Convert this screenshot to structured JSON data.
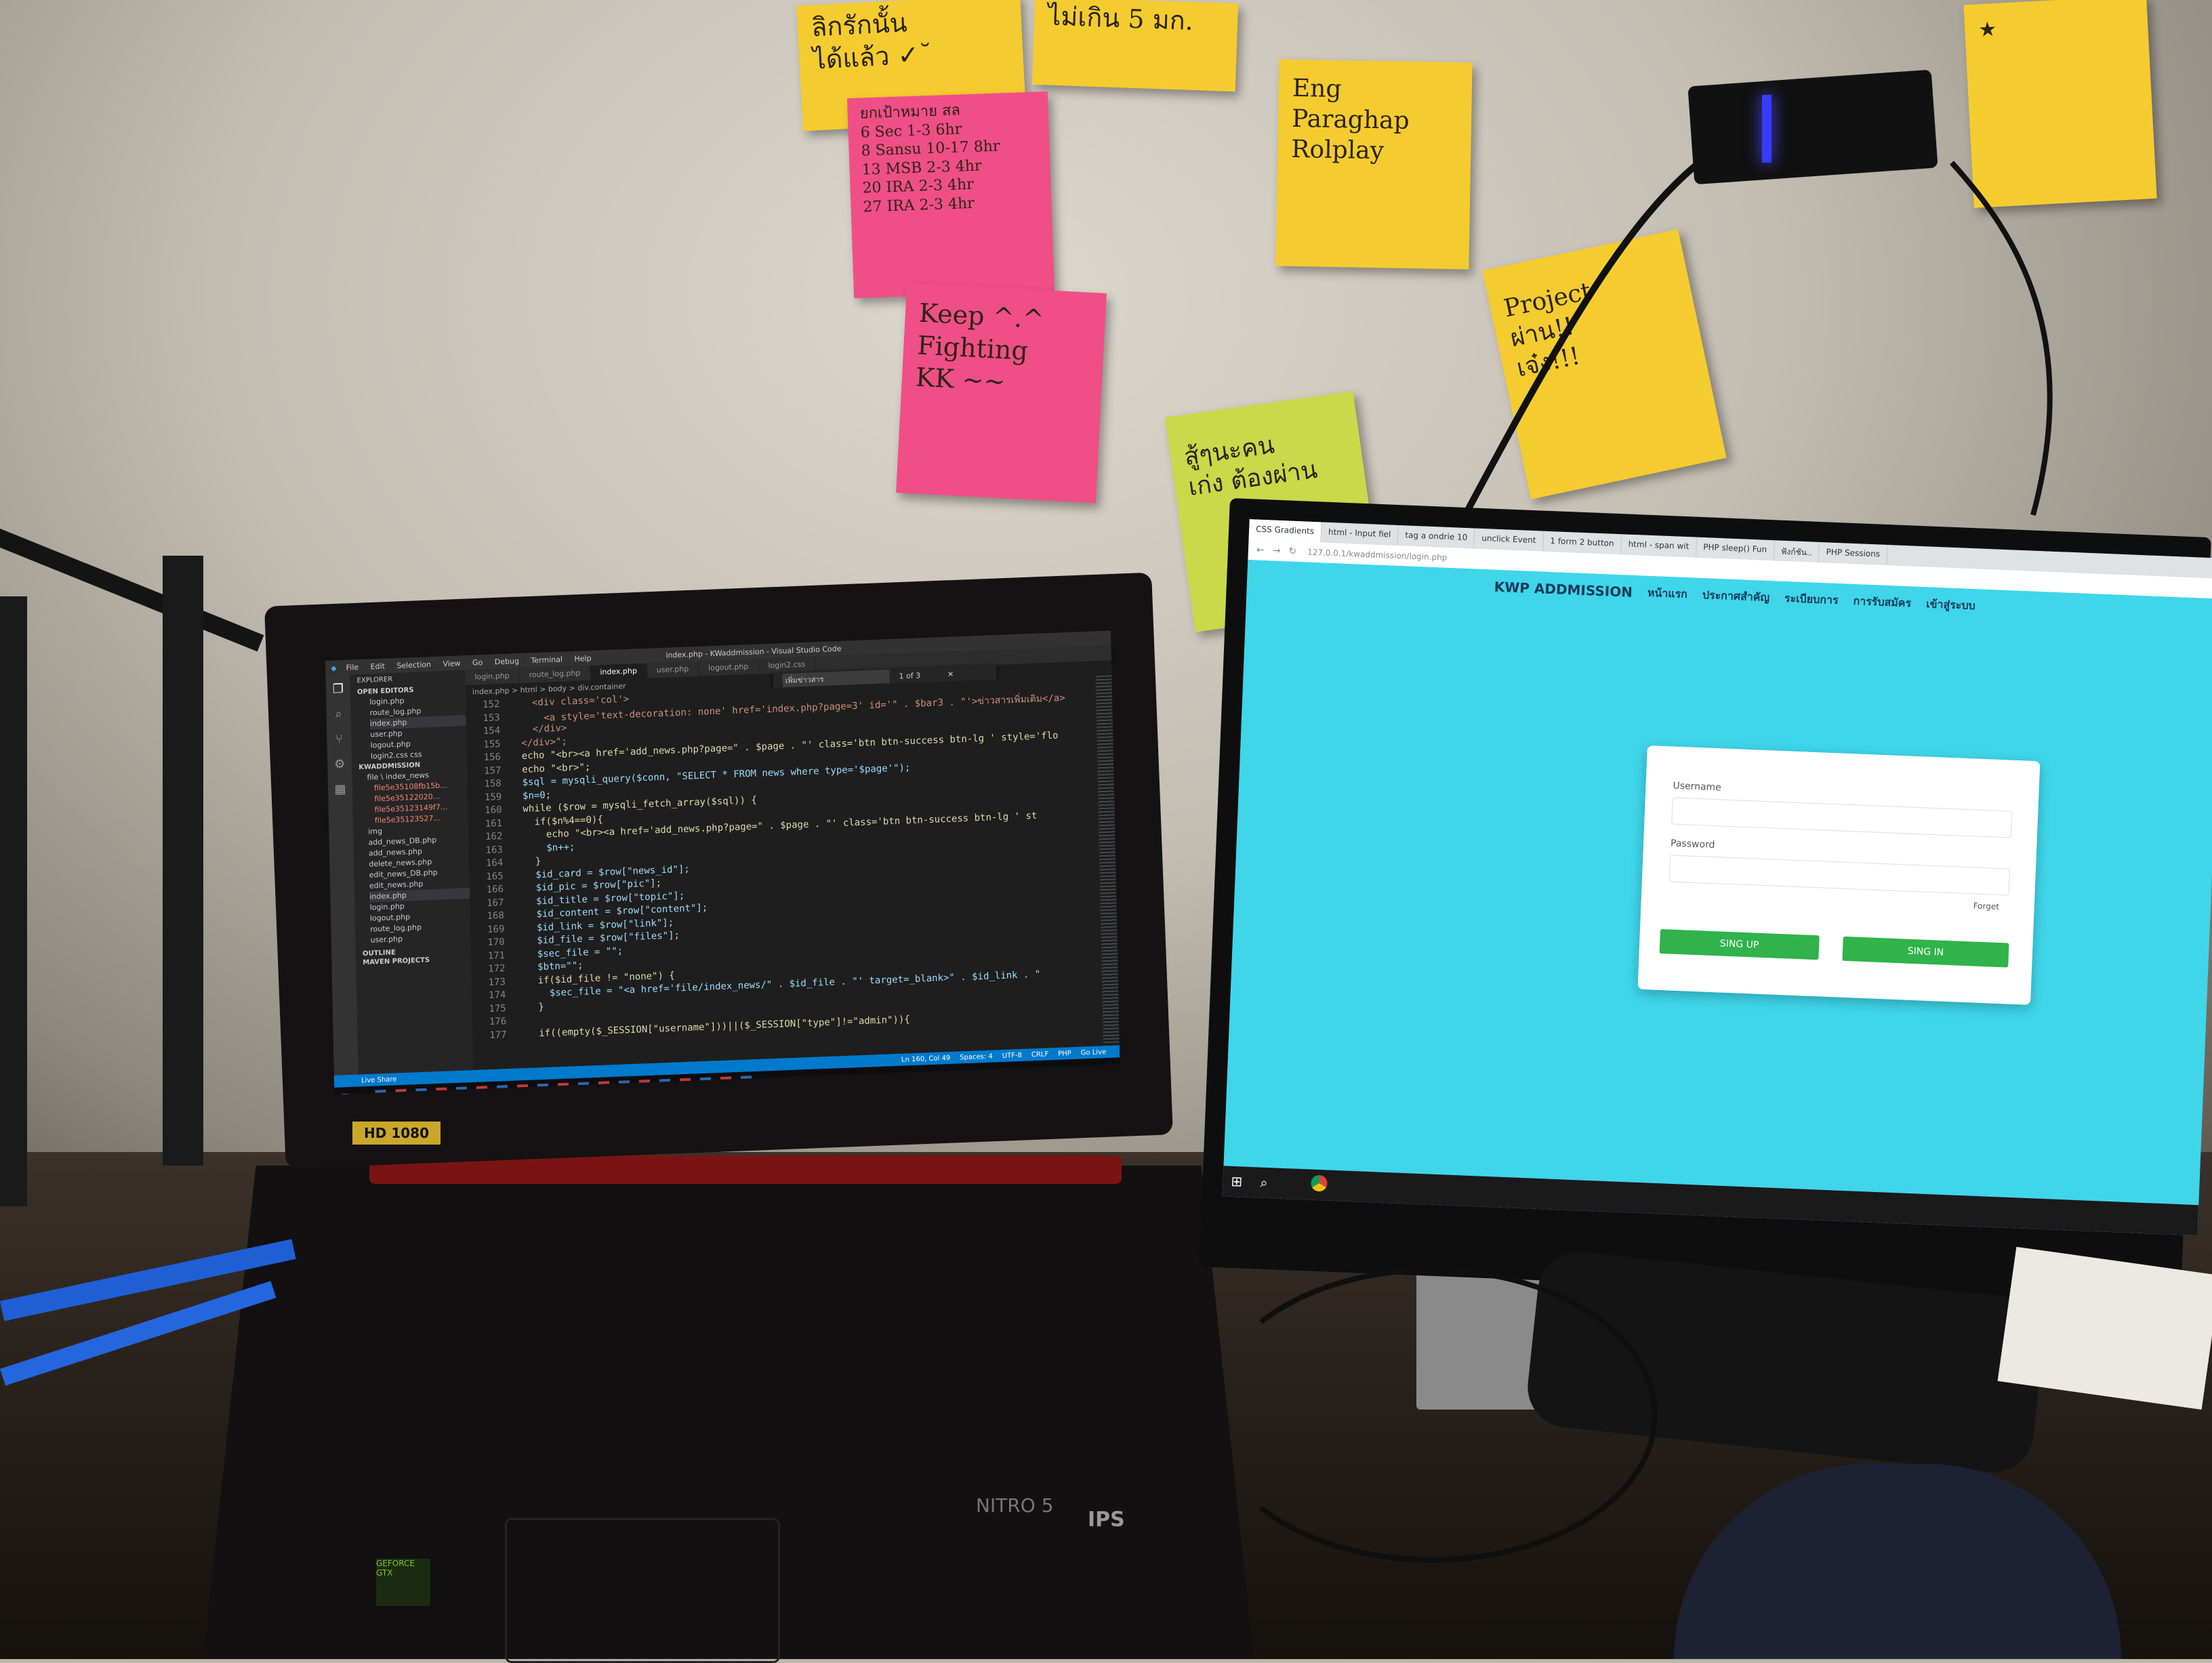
{
  "notes": [
    {
      "id": "yellow-1",
      "lines": [
        "ลิกรักนั้น",
        "ได้แล้ว ✓˘"
      ]
    },
    {
      "id": "yellow-2",
      "lines": [
        "ไม่เกิน 5 มก."
      ]
    },
    {
      "id": "pink-schedule",
      "lines": [
        "ยกเป้าหมาย สล",
        "6  Sec 1-3  6hr",
        "8  Sansu  10-17  8hr",
        "13  MSB 2-3  4hr",
        "20  IRA 2-3  4hr",
        "27  IRA 2-3  4hr"
      ]
    },
    {
      "id": "yellow-eng",
      "lines": [
        "Eng",
        "Paraghap",
        "Rolplay"
      ]
    },
    {
      "id": "pink-keep",
      "lines": [
        "Keep   ^.^",
        "Fighting",
        "KK  ~~"
      ]
    },
    {
      "id": "yellow-project",
      "lines": [
        "Project",
        "ผ่าน!!",
        "เจ๋ง!!!"
      ]
    },
    {
      "id": "lime",
      "lines": [
        "สู้ๆนะคน",
        "เก่ง ต้องผ่าน"
      ]
    },
    {
      "id": "yellow-topright",
      "lines": [
        "★"
      ]
    }
  ],
  "vscode": {
    "title": "index.php - KWaddmission - Visual Studio Code",
    "menu": [
      "File",
      "Edit",
      "Selection",
      "View",
      "Go",
      "Debug",
      "Terminal",
      "Help"
    ],
    "tabs": [
      "login.php",
      "route_log.php",
      "index.php",
      "user.php",
      "logout.php",
      "login2.css"
    ],
    "active_tab": "index.php",
    "breadcrumb": "index.php > html > body > div.container",
    "find_text": "เพิ่มข่าวสาร",
    "find_count": "1 of 3",
    "sidebar": {
      "explorer": "EXPLORER",
      "open_editors": "OPEN EDITORS",
      "open_files": [
        "login.php",
        "route_log.php",
        "index.php",
        "user.php",
        "logout.php",
        "login2.css css"
      ],
      "project": "KWADDMISSION",
      "tree": [
        "file \\ index_news",
        "file5e35108fb15b...",
        "file5e35122020...",
        "file5e35123149f7...",
        "file5e35123527...",
        "img",
        "add_news_DB.php",
        "add_news.php",
        "delete_news.php",
        "edit_news_DB.php",
        "edit_news.php",
        "index.php",
        "login.php",
        "logout.php",
        "route_log.php",
        "user.php"
      ],
      "outline": "OUTLINE",
      "maven": "MAVEN PROJECTS"
    },
    "lines": [
      {
        "n": "152",
        "t": "    <div class='col'>"
      },
      {
        "n": "153",
        "t": "      <a style='text-decoration: none' href='index.php?page=3' id='\" . $bar3 . \"'>ข่าวสารเพิ่มเติม</a>"
      },
      {
        "n": "154",
        "t": "    </div>"
      },
      {
        "n": "155",
        "t": "  </div>\";"
      },
      {
        "n": "156",
        "t": "  echo \"<br><a href='add_news.php?page=\" . $page . \"' class='btn btn-success btn-lg ' style='flo"
      },
      {
        "n": "157",
        "t": "  echo \"<br>\";"
      },
      {
        "n": "158",
        "t": "  $sql = mysqli_query($conn, \"SELECT * FROM news where type='$page'\");"
      },
      {
        "n": "159",
        "t": "  $n=0;"
      },
      {
        "n": "160",
        "t": "  while ($row = mysqli_fetch_array($sql)) {"
      },
      {
        "n": "161",
        "t": "    if($n%4==0){"
      },
      {
        "n": "162",
        "t": "      echo \"<br><a href='add_news.php?page=\" . $page . \"' class='btn btn-success btn-lg ' st"
      },
      {
        "n": "163",
        "t": "      $n++;"
      },
      {
        "n": "164",
        "t": "    }"
      },
      {
        "n": "165",
        "t": "    $id_card = $row[\"news_id\"];"
      },
      {
        "n": "166",
        "t": "    $id_pic = $row[\"pic\"];"
      },
      {
        "n": "167",
        "t": "    $id_title = $row[\"topic\"];"
      },
      {
        "n": "168",
        "t": "    $id_content = $row[\"content\"];"
      },
      {
        "n": "169",
        "t": "    $id_link = $row[\"link\"];"
      },
      {
        "n": "170",
        "t": "    $id_file = $row[\"files\"];"
      },
      {
        "n": "171",
        "t": "    $sec_file = \"\";"
      },
      {
        "n": "172",
        "t": "    $btn=\"\";"
      },
      {
        "n": "173",
        "t": "    if($id_file != \"none\") {"
      },
      {
        "n": "174",
        "t": "      $sec_file = \"<a href='file/index_news/\" . $id_file . \"' target=_blank>\" . $id_link . \""
      },
      {
        "n": "175",
        "t": "    }"
      },
      {
        "n": "176",
        "t": ""
      },
      {
        "n": "177",
        "t": "    if((empty($_SESSION[\"username\"]))||($_SESSION[\"type\"]!=\"admin\")){"
      }
    ],
    "status": {
      "left": "Live Share",
      "position": "Ln 160, Col 49",
      "spaces": "Spaces: 4",
      "encoding": "UTF-8",
      "eol": "CRLF",
      "lang": "PHP",
      "golive": "Go Live"
    },
    "sticker": "HD 1080"
  },
  "browser": {
    "tabs": [
      "CSS Gradients",
      "html - Input fiel",
      "tag a ondrie 10",
      "unclick Event",
      "1 form 2 button",
      "html - span wit",
      "PHP sleep() Fun",
      "ฟังก์ชัน..",
      "PHP Sessions"
    ],
    "address": "127.0.0.1/kwaddmission/login.php"
  },
  "site": {
    "brand": "KWP ADDMISSION",
    "nav": [
      "หน้าแรก",
      "ประกาศสำคัญ",
      "ระเบียบการ",
      "การรับสมัคร",
      "เข้าสู่ระบบ"
    ],
    "username_label": "Username",
    "password_label": "Password",
    "forget": "Forget",
    "signup": "SING UP",
    "signin": "SING IN"
  },
  "laptop": {
    "model": "NITRO 5",
    "badge": "IPS",
    "gpu": "GEFORCE GTX"
  }
}
